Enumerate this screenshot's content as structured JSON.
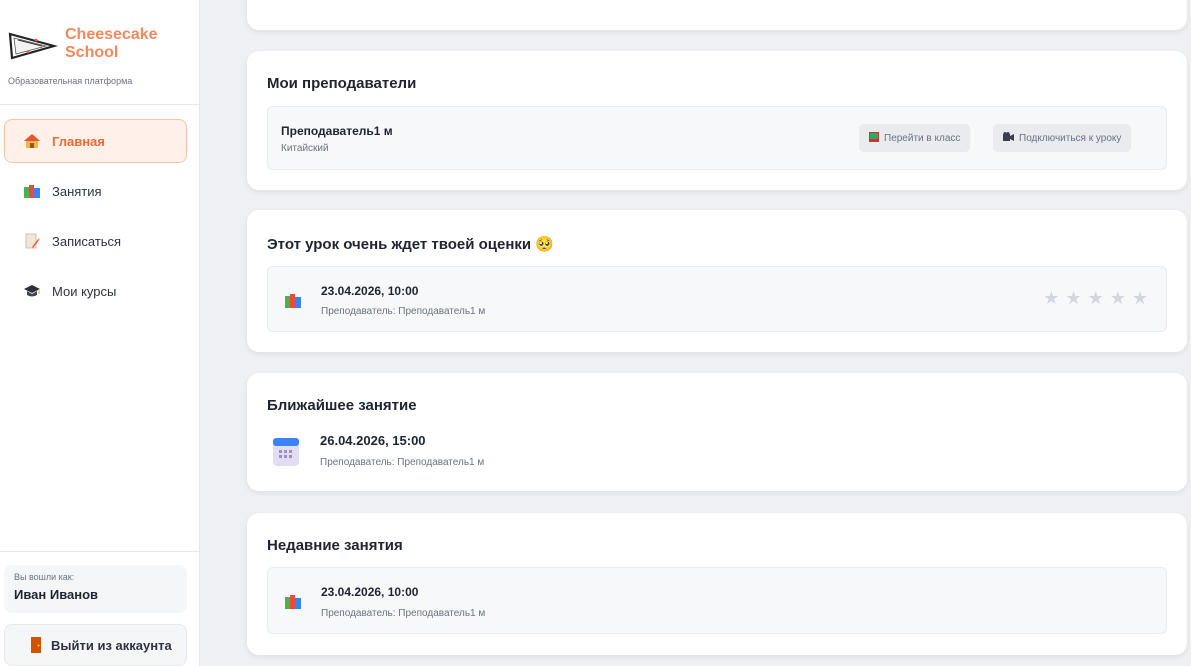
{
  "sidebar": {
    "brand_name": "Cheesecake School",
    "brand_subtitle": "Образовательная платформа",
    "items": [
      {
        "label": "Главная",
        "icon": "home-icon",
        "active": true
      },
      {
        "label": "Занятия",
        "icon": "books-icon",
        "active": false
      },
      {
        "label": "Записаться",
        "icon": "signup-icon",
        "active": false
      },
      {
        "label": "Мои курсы",
        "icon": "graduation-cap-icon",
        "active": false
      }
    ],
    "logged_in_label": "Вы вошли как:",
    "user_name": "Иван Иванов",
    "logout_label": "Выйти из аккаунта"
  },
  "teachers": {
    "title": "Мои преподаватели",
    "teacher_name": "Преподаватель1 м",
    "subject": "Китайский",
    "goto_class_label": "Перейти в класс",
    "join_lesson_label": "Подключиться к уроку"
  },
  "rate": {
    "title": "Этот урок очень ждет твоей оценки",
    "emoji": "🥺",
    "date": "23.04.2026, 10:00",
    "teacher": "Преподаватель: Преподаватель1 м",
    "rating": 0,
    "max_rating": 5
  },
  "next_lesson": {
    "title": "Ближайшее занятие",
    "date": "26.04.2026, 15:00",
    "teacher": "Преподаватель: Преподаватель1 м"
  },
  "recent": {
    "title": "Недавние занятия",
    "date": "23.04.2026, 10:00",
    "teacher": "Преподаватель: Преподаватель1 м"
  },
  "colors": {
    "accent": "#f06a35",
    "brand": "#f08a5d",
    "star_empty": "#d3d6dc"
  }
}
